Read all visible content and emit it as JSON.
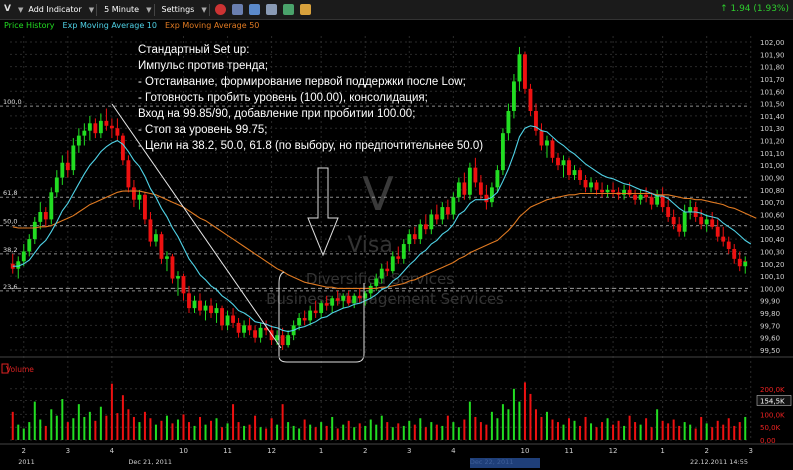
{
  "toolbar": {
    "symbol": "V",
    "add_indicator": "Add Indicator",
    "interval": "5 Minute",
    "settings": "Settings",
    "price_change": "↑ 1.94 (1.93%)"
  },
  "legend": {
    "item1": "Price History",
    "item2": "Exp Moving Average 10",
    "item3": "Exp Moving Average 50"
  },
  "volume_label": "Volume",
  "watermark": {
    "ticker": "V",
    "company": "Visa",
    "line1": "Diversified Services",
    "line2": "Business Management Services"
  },
  "annotation": [
    "Стандартный Set up:",
    "  Импульс против тренда;",
    "- Отстаивание, формирование первой поддержки после Low;",
    "- Готовность пробить уровень (100.00), консолидация;",
    "  Вход на 99.85/90, добавление при пробитии 100.00;",
    "- Стоп за уровень 99.75;",
    "- Цели на 38.2, 50.0, 61.8 (по выбору, но предпочтительнее 50.0)"
  ],
  "colors": {
    "up": "#22dd22",
    "down": "#ee1111",
    "ema10": "#4fd2e6",
    "ema50": "#e07a22",
    "fib": "#bbbbbb",
    "grid": "#2a2a2a"
  },
  "chart_data": {
    "type": "candlestick",
    "price_axis": {
      "min": 99.5,
      "max": 102.0,
      "ticks": [
        "102,00",
        "101,90",
        "101,80",
        "101,70",
        "101,60",
        "101,50",
        "101,40",
        "101,30",
        "101,20",
        "101,10",
        "101,00",
        "100,90",
        "100,80",
        "100,70",
        "100,60",
        "100,50",
        "100,40",
        "100,30",
        "100,20",
        "100,10",
        "100,00",
        "99,90",
        "99,80",
        "99,70",
        "99,60",
        "99,50"
      ]
    },
    "fib_levels": [
      {
        "label": "100,0",
        "value": 101.48
      },
      {
        "label": "61,8",
        "value": 100.74
      },
      {
        "label": "50,0",
        "value": 100.51
      },
      {
        "label": "38,2",
        "value": 100.28
      },
      {
        "label": "23,6",
        "value": 99.98
      }
    ],
    "reference_lines": [
      100.0
    ],
    "time_ticks": [
      {
        "label": "2",
        "i": 2
      },
      {
        "label": "3",
        "i": 10
      },
      {
        "label": "4",
        "i": 18
      },
      {
        "label": "10",
        "i": 31
      },
      {
        "label": "11",
        "i": 39
      },
      {
        "label": "12",
        "i": 47
      },
      {
        "label": "1",
        "i": 56
      },
      {
        "label": "2",
        "i": 64
      },
      {
        "label": "3",
        "i": 72
      },
      {
        "label": "4",
        "i": 80
      },
      {
        "label": "10",
        "i": 93
      },
      {
        "label": "11",
        "i": 101
      },
      {
        "label": "12",
        "i": 109
      },
      {
        "label": "1",
        "i": 118
      },
      {
        "label": "2",
        "i": 126
      },
      {
        "label": "3",
        "i": 134
      }
    ],
    "date_labels": [
      {
        "label": "2011",
        "i": 1
      },
      {
        "label": "Dec 21, 2011",
        "i": 21
      },
      {
        "label": "Dec 22, 2011",
        "i": 83
      },
      {
        "label": "22.12.2011 14:55",
        "i": 133
      }
    ],
    "volume_axis": {
      "ticks": [
        "200,0K",
        "154,5K",
        "100,0K",
        "50,0K",
        "0,00"
      ],
      "current": "154,5K"
    },
    "candles": [
      [
        100.2,
        100.28,
        100.12,
        100.16
      ],
      [
        100.16,
        100.26,
        100.08,
        100.22
      ],
      [
        100.22,
        100.36,
        100.18,
        100.3
      ],
      [
        100.3,
        100.44,
        100.26,
        100.4
      ],
      [
        100.4,
        100.58,
        100.36,
        100.54
      ],
      [
        100.54,
        100.7,
        100.48,
        100.62
      ],
      [
        100.62,
        100.66,
        100.5,
        100.56
      ],
      [
        100.56,
        100.82,
        100.52,
        100.78
      ],
      [
        100.78,
        100.96,
        100.74,
        100.9
      ],
      [
        100.9,
        101.08,
        100.84,
        101.02
      ],
      [
        101.02,
        101.12,
        100.9,
        100.96
      ],
      [
        100.96,
        101.22,
        100.92,
        101.16
      ],
      [
        101.16,
        101.3,
        101.1,
        101.24
      ],
      [
        101.24,
        101.34,
        101.16,
        101.28
      ],
      [
        101.28,
        101.4,
        101.2,
        101.34
      ],
      [
        101.34,
        101.38,
        101.22,
        101.26
      ],
      [
        101.26,
        101.42,
        101.22,
        101.36
      ],
      [
        101.36,
        101.46,
        101.28,
        101.32
      ],
      [
        101.32,
        101.38,
        101.22,
        101.3
      ],
      [
        101.3,
        101.38,
        101.2,
        101.24
      ],
      [
        101.24,
        101.26,
        101.0,
        101.04
      ],
      [
        101.04,
        101.08,
        100.78,
        100.82
      ],
      [
        100.82,
        100.88,
        100.66,
        100.72
      ],
      [
        100.72,
        100.8,
        100.64,
        100.76
      ],
      [
        100.76,
        100.78,
        100.52,
        100.56
      ],
      [
        100.56,
        100.62,
        100.34,
        100.38
      ],
      [
        100.38,
        100.48,
        100.34,
        100.44
      ],
      [
        100.44,
        100.46,
        100.2,
        100.24
      ],
      [
        100.24,
        100.3,
        100.14,
        100.26
      ],
      [
        100.26,
        100.28,
        100.04,
        100.08
      ],
      [
        100.08,
        100.14,
        99.94,
        100.1
      ],
      [
        100.1,
        100.12,
        99.9,
        99.96
      ],
      [
        99.96,
        100.02,
        99.8,
        99.84
      ],
      [
        99.84,
        99.94,
        99.8,
        99.9
      ],
      [
        99.9,
        99.96,
        99.78,
        99.82
      ],
      [
        99.82,
        99.9,
        99.74,
        99.86
      ],
      [
        99.86,
        99.92,
        99.76,
        99.8
      ],
      [
        99.8,
        99.88,
        99.72,
        99.84
      ],
      [
        99.84,
        99.86,
        99.66,
        99.7
      ],
      [
        99.7,
        99.82,
        99.66,
        99.78
      ],
      [
        99.78,
        99.84,
        99.68,
        99.72
      ],
      [
        99.72,
        99.76,
        99.6,
        99.64
      ],
      [
        99.64,
        99.74,
        99.6,
        99.7
      ],
      [
        99.7,
        99.76,
        99.62,
        99.66
      ],
      [
        99.66,
        99.7,
        99.56,
        99.6
      ],
      [
        99.6,
        99.72,
        99.56,
        99.68
      ],
      [
        99.68,
        99.74,
        99.62,
        99.66
      ],
      [
        99.66,
        99.7,
        99.54,
        99.58
      ],
      [
        99.58,
        99.66,
        99.54,
        99.62
      ],
      [
        99.62,
        99.68,
        99.5,
        99.54
      ],
      [
        99.54,
        99.66,
        99.52,
        99.62
      ],
      [
        99.62,
        99.74,
        99.58,
        99.7
      ],
      [
        99.7,
        99.8,
        99.66,
        99.76
      ],
      [
        99.76,
        99.82,
        99.7,
        99.74
      ],
      [
        99.74,
        99.86,
        99.7,
        99.82
      ],
      [
        99.82,
        99.9,
        99.76,
        99.8
      ],
      [
        99.8,
        99.9,
        99.76,
        99.88
      ],
      [
        99.88,
        99.94,
        99.82,
        99.86
      ],
      [
        99.86,
        99.94,
        99.8,
        99.92
      ],
      [
        99.92,
        99.98,
        99.86,
        99.9
      ],
      [
        99.9,
        99.96,
        99.84,
        99.94
      ],
      [
        99.94,
        99.98,
        99.86,
        99.88
      ],
      [
        99.88,
        99.96,
        99.84,
        99.94
      ],
      [
        99.94,
        100.0,
        99.88,
        99.92
      ],
      [
        99.92,
        99.98,
        99.86,
        99.96
      ],
      [
        99.96,
        100.04,
        99.92,
        100.02
      ],
      [
        100.02,
        100.12,
        99.98,
        100.08
      ],
      [
        100.08,
        100.2,
        100.04,
        100.16
      ],
      [
        100.16,
        100.22,
        100.1,
        100.14
      ],
      [
        100.14,
        100.3,
        100.12,
        100.26
      ],
      [
        100.26,
        100.34,
        100.2,
        100.24
      ],
      [
        100.24,
        100.4,
        100.2,
        100.36
      ],
      [
        100.36,
        100.48,
        100.3,
        100.44
      ],
      [
        100.44,
        100.5,
        100.36,
        100.4
      ],
      [
        100.4,
        100.56,
        100.36,
        100.52
      ],
      [
        100.52,
        100.6,
        100.44,
        100.48
      ],
      [
        100.48,
        100.64,
        100.44,
        100.6
      ],
      [
        100.6,
        100.68,
        100.52,
        100.56
      ],
      [
        100.56,
        100.7,
        100.52,
        100.66
      ],
      [
        100.66,
        100.72,
        100.56,
        100.6
      ],
      [
        100.6,
        100.78,
        100.56,
        100.74
      ],
      [
        100.74,
        100.9,
        100.7,
        100.86
      ],
      [
        100.86,
        100.94,
        100.72,
        100.76
      ],
      [
        100.76,
        101.02,
        100.72,
        100.98
      ],
      [
        100.98,
        101.06,
        100.82,
        100.86
      ],
      [
        100.86,
        100.92,
        100.72,
        100.76
      ],
      [
        100.76,
        100.84,
        100.64,
        100.7
      ],
      [
        100.7,
        100.86,
        100.66,
        100.82
      ],
      [
        100.82,
        101.0,
        100.78,
        100.96
      ],
      [
        100.96,
        101.3,
        100.92,
        101.26
      ],
      [
        101.26,
        101.5,
        101.2,
        101.44
      ],
      [
        101.44,
        101.74,
        101.38,
        101.68
      ],
      [
        101.68,
        101.96,
        101.6,
        101.9
      ],
      [
        101.9,
        101.92,
        101.58,
        101.62
      ],
      [
        101.62,
        101.66,
        101.4,
        101.44
      ],
      [
        101.44,
        101.5,
        101.24,
        101.28
      ],
      [
        101.28,
        101.34,
        101.12,
        101.16
      ],
      [
        101.16,
        101.24,
        101.06,
        101.2
      ],
      [
        101.2,
        101.22,
        101.02,
        101.06
      ],
      [
        101.06,
        101.1,
        100.96,
        101.0
      ],
      [
        101.0,
        101.08,
        100.9,
        101.04
      ],
      [
        101.04,
        101.06,
        100.88,
        100.92
      ],
      [
        100.92,
        101.0,
        100.88,
        100.96
      ],
      [
        100.96,
        100.98,
        100.84,
        100.88
      ],
      [
        100.88,
        100.92,
        100.78,
        100.82
      ],
      [
        100.82,
        100.9,
        100.78,
        100.86
      ],
      [
        100.86,
        100.88,
        100.76,
        100.8
      ],
      [
        100.8,
        100.86,
        100.74,
        100.78
      ],
      [
        100.78,
        100.84,
        100.74,
        100.8
      ],
      [
        100.8,
        100.86,
        100.74,
        100.78
      ],
      [
        100.78,
        100.82,
        100.72,
        100.76
      ],
      [
        100.76,
        100.84,
        100.72,
        100.8
      ],
      [
        100.8,
        100.86,
        100.74,
        100.76
      ],
      [
        100.76,
        100.8,
        100.68,
        100.72
      ],
      [
        100.72,
        100.8,
        100.68,
        100.76
      ],
      [
        100.76,
        100.82,
        100.7,
        100.74
      ],
      [
        100.74,
        100.78,
        100.64,
        100.68
      ],
      [
        100.68,
        100.8,
        100.66,
        100.76
      ],
      [
        100.76,
        100.82,
        100.62,
        100.66
      ],
      [
        100.66,
        100.72,
        100.54,
        100.58
      ],
      [
        100.58,
        100.64,
        100.48,
        100.52
      ],
      [
        100.52,
        100.58,
        100.42,
        100.46
      ],
      [
        100.46,
        100.68,
        100.42,
        100.62
      ],
      [
        100.62,
        100.72,
        100.56,
        100.66
      ],
      [
        100.66,
        100.7,
        100.54,
        100.58
      ],
      [
        100.58,
        100.64,
        100.48,
        100.52
      ],
      [
        100.52,
        100.6,
        100.46,
        100.56
      ],
      [
        100.56,
        100.62,
        100.48,
        100.5
      ],
      [
        100.5,
        100.56,
        100.38,
        100.42
      ],
      [
        100.42,
        100.5,
        100.34,
        100.38
      ],
      [
        100.38,
        100.42,
        100.28,
        100.32
      ],
      [
        100.32,
        100.36,
        100.2,
        100.24
      ],
      [
        100.24,
        100.3,
        100.14,
        100.18
      ],
      [
        100.18,
        100.26,
        100.12,
        100.22
      ]
    ],
    "volume": [
      110,
      60,
      45,
      70,
      150,
      80,
      55,
      120,
      95,
      160,
      70,
      85,
      140,
      90,
      110,
      75,
      130,
      95,
      220,
      105,
      175,
      120,
      90,
      70,
      110,
      85,
      60,
      75,
      95,
      65,
      80,
      100,
      70,
      55,
      90,
      60,
      75,
      85,
      50,
      65,
      140,
      70,
      55,
      60,
      95,
      50,
      45,
      85,
      60,
      140,
      70,
      55,
      45,
      80,
      60,
      50,
      70,
      55,
      90,
      45,
      60,
      75,
      50,
      65,
      55,
      80,
      60,
      95,
      70,
      50,
      65,
      55,
      75,
      60,
      85,
      50,
      70,
      60,
      55,
      95,
      70,
      50,
      80,
      150,
      90,
      70,
      60,
      110,
      85,
      140,
      120,
      200,
      150,
      225,
      180,
      120,
      90,
      110,
      80,
      70,
      60,
      85,
      75,
      55,
      90,
      65,
      50,
      70,
      85,
      60,
      75,
      55,
      95,
      70,
      60,
      85,
      50,
      120,
      75,
      65,
      80,
      55,
      70,
      60,
      45,
      90,
      65,
      50,
      75,
      60,
      85,
      55,
      70,
      90
    ],
    "ema10": [
      100.18,
      100.18,
      100.2,
      100.23,
      100.29,
      100.35,
      100.39,
      100.46,
      100.54,
      100.63,
      100.69,
      100.77,
      100.85,
      100.93,
      101.0,
      101.05,
      101.11,
      101.15,
      101.18,
      101.2,
      101.17,
      101.11,
      101.04,
      100.99,
      100.91,
      100.81,
      100.74,
      100.65,
      100.58,
      100.49,
      100.42,
      100.33,
      100.24,
      100.18,
      100.11,
      100.07,
      100.02,
      99.99,
      99.94,
      99.91,
      99.87,
      99.82,
      99.8,
      99.77,
      99.73,
      99.72,
      99.71,
      99.69,
      99.68,
      99.66,
      99.65,
      99.66,
      99.68,
      99.69,
      99.71,
      99.73,
      99.76,
      99.77,
      99.8,
      99.82,
      99.84,
      99.85,
      99.87,
      99.88,
      99.9,
      99.92,
      99.95,
      99.99,
      100.01,
      100.06,
      100.09,
      100.14,
      100.19,
      100.23,
      100.28,
      100.31,
      100.36,
      100.39,
      100.44,
      100.47,
      100.52,
      100.6,
      100.63,
      100.69,
      100.72,
      100.72,
      100.72,
      100.74,
      100.78,
      100.87,
      100.97,
      101.09,
      101.23,
      101.3,
      101.32,
      101.31,
      101.28,
      101.27,
      101.23,
      101.19,
      101.16,
      101.12,
      101.09,
      101.05,
      101.01,
      100.98,
      100.95,
      100.92,
      100.9,
      100.89,
      100.87,
      100.85,
      100.84,
      100.82,
      100.8,
      100.79,
      100.77,
      100.75,
      100.75,
      100.73,
      100.69,
      100.65,
      100.62,
      100.62,
      100.62,
      100.61,
      100.59,
      100.58,
      100.57,
      100.53,
      100.5,
      100.47,
      100.43,
      100.39,
      100.36
    ],
    "ema50": [
      100.5,
      100.49,
      100.49,
      100.49,
      100.49,
      100.5,
      100.5,
      100.51,
      100.53,
      100.55,
      100.57,
      100.59,
      100.62,
      100.65,
      100.68,
      100.7,
      100.72,
      100.74,
      100.76,
      100.78,
      100.79,
      100.79,
      100.79,
      100.79,
      100.78,
      100.77,
      100.76,
      100.74,
      100.72,
      100.7,
      100.68,
      100.66,
      100.63,
      100.6,
      100.57,
      100.55,
      100.52,
      100.49,
      100.46,
      100.43,
      100.4,
      100.37,
      100.34,
      100.31,
      100.28,
      100.25,
      100.22,
      100.19,
      100.16,
      100.14,
      100.11,
      100.09,
      100.07,
      100.05,
      100.04,
      100.03,
      100.02,
      100.01,
      100.01,
      100.0,
      100.0,
      100.0,
      100.0,
      100.0,
      100.0,
      100.0,
      100.0,
      100.01,
      100.01,
      100.02,
      100.03,
      100.04,
      100.06,
      100.07,
      100.09,
      100.11,
      100.13,
      100.15,
      100.17,
      100.19,
      100.21,
      100.24,
      100.26,
      100.29,
      100.31,
      100.33,
      100.35,
      100.37,
      100.39,
      100.43,
      100.47,
      100.52,
      100.58,
      100.62,
      100.66,
      100.68,
      100.7,
      100.72,
      100.73,
      100.74,
      100.75,
      100.76,
      100.76,
      100.77,
      100.77,
      100.77,
      100.77,
      100.77,
      100.77,
      100.77,
      100.77,
      100.77,
      100.77,
      100.77,
      100.77,
      100.77,
      100.77,
      100.76,
      100.76,
      100.76,
      100.75,
      100.74,
      100.73,
      100.73,
      100.72,
      100.72,
      100.71,
      100.7,
      100.69,
      100.68,
      100.66,
      100.65,
      100.63,
      100.61,
      100.59,
      100.57
    ]
  }
}
